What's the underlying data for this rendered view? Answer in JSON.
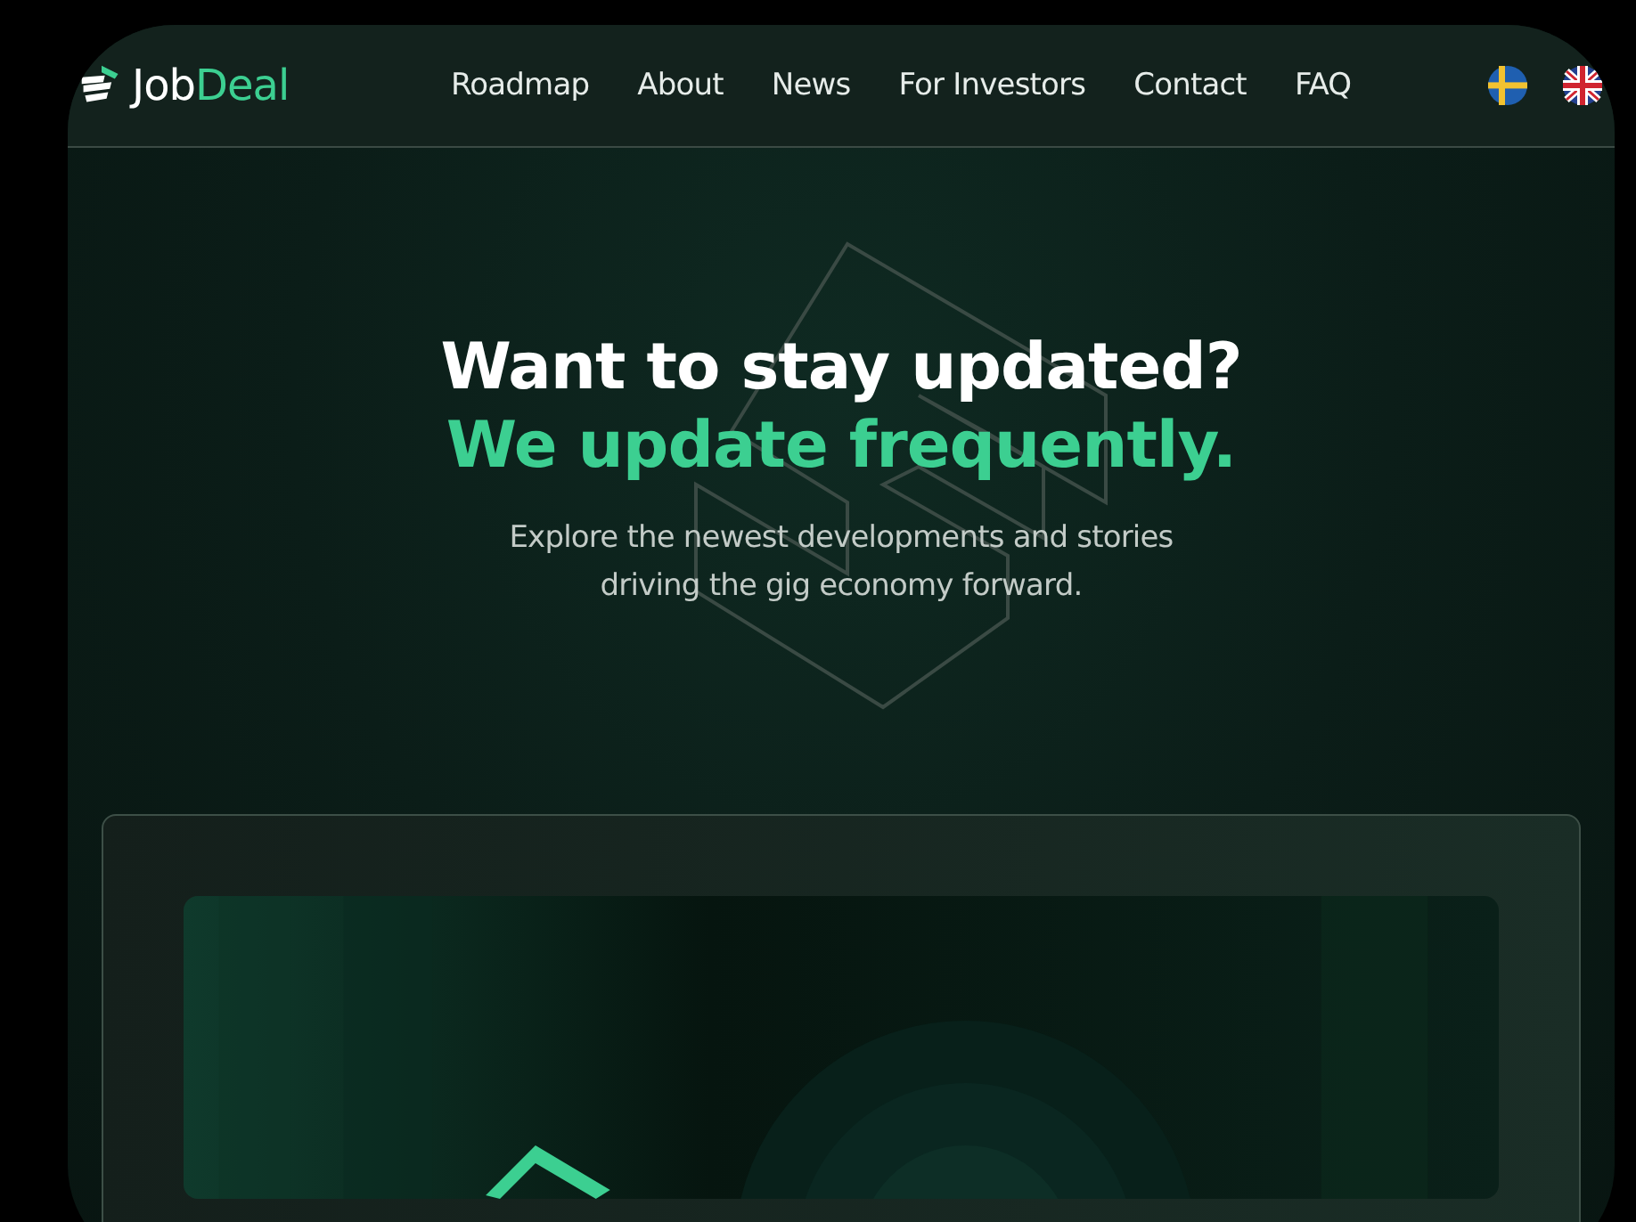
{
  "header": {
    "logo": {
      "part1": "Job",
      "part2": "Deal"
    },
    "nav": [
      {
        "label": "Roadmap"
      },
      {
        "label": "About"
      },
      {
        "label": "News"
      },
      {
        "label": "For Investors"
      },
      {
        "label": "Contact"
      },
      {
        "label": "FAQ"
      }
    ],
    "languages": [
      {
        "kind": "sweden"
      },
      {
        "kind": "uk"
      }
    ]
  },
  "hero": {
    "title": "Want to stay updated?",
    "subtitle": "We update frequently.",
    "text": "Explore the newest developments and stories driving the gig economy forward."
  }
}
